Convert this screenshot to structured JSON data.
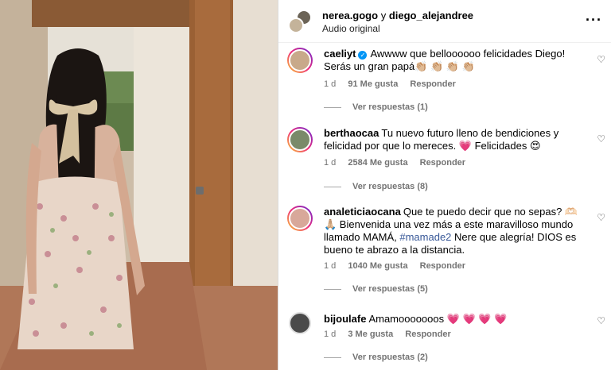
{
  "post": {
    "author_primary": "nerea.gogo",
    "author_connector": "y",
    "author_secondary": "diego_alejandree",
    "audio": "Audio original",
    "more_icon": "more-options-icon"
  },
  "comments": [
    {
      "user": "caeliyt",
      "verified": true,
      "text": "Awwww que belloooooo felicidades Diego! Serás un gran papá👏🏼 👏🏼 👏🏼 👏🏼",
      "age": "1 d",
      "likes": "91 Me gusta",
      "reply": "Responder",
      "view_replies": "Ver respuestas (1)"
    },
    {
      "user": "berthaocaa",
      "verified": false,
      "text": "Tu nuevo futuro lleno de bendiciones y felicidad por que lo mereces. 💗 Felicidades 😍",
      "age": "1 d",
      "likes": "2584 Me gusta",
      "reply": "Responder",
      "view_replies": "Ver respuestas (8)"
    },
    {
      "user": "analeticiaocana",
      "verified": false,
      "text_before": "Que te puedo decir que no sepas? 🫶🏻 🙏🏼 Bienvenida una vez más a este maravilloso mundo llamado MAMÁ,",
      "hashtag": "#mamade2",
      "text_after": "Nere que alegría! DIOS es bueno te abrazo a la distancia.",
      "age": "1 d",
      "likes": "1040 Me gusta",
      "reply": "Responder",
      "view_replies": "Ver respuestas (5)"
    },
    {
      "user": "bijoulafe",
      "verified": false,
      "text": "Amamooooooos 💗 💗 💗 💗",
      "age": "1 d",
      "likes": "3 Me gusta",
      "reply": "Responder",
      "view_replies": "Ver respuestas (2)"
    }
  ],
  "heart_glyph": "♡"
}
